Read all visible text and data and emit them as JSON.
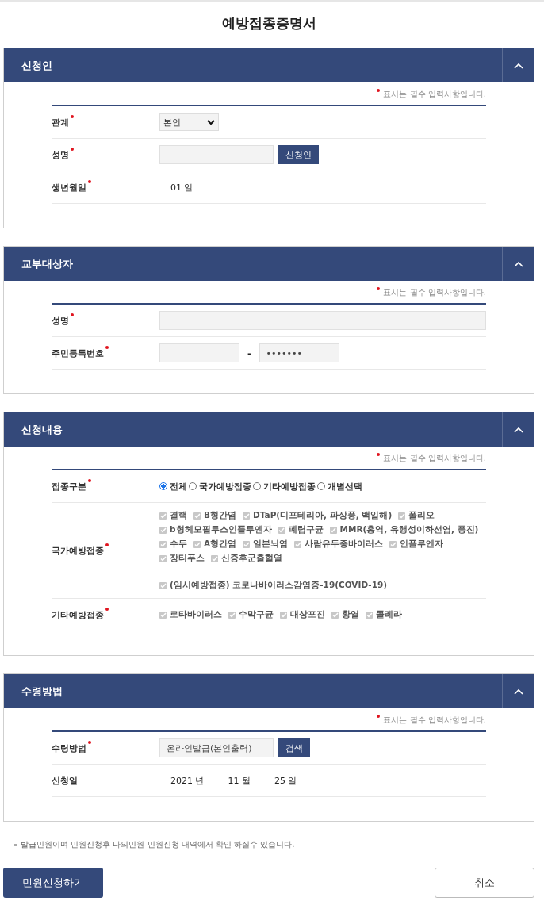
{
  "title": "예방접종증명서",
  "sections": [
    {
      "title": "신청인",
      "expanded": true,
      "note": "표시는 필수 입력사항입니다.",
      "rows": [
        {
          "kind": "select",
          "label": "관계",
          "required": true,
          "value": "본인"
        },
        {
          "kind": "text_button",
          "label": "성명",
          "required": true,
          "button": "신청인"
        },
        {
          "kind": "date",
          "label": "생년월일",
          "required": true,
          "parts": [
            {
              "value": "01",
              "unit": "일"
            }
          ]
        }
      ]
    },
    {
      "title": "교부대상자",
      "expanded": true,
      "note": "표시는 필수 입력사항입니다.",
      "rows": [
        {
          "kind": "text_wide",
          "label": "성명",
          "required": true
        },
        {
          "kind": "rrn",
          "label": "주민등록번호",
          "required": true,
          "dash": "-",
          "second": "•••••••"
        }
      ]
    },
    {
      "title": "신청내용",
      "expanded": true,
      "note": "표시는 필수 입력사항입니다.",
      "rows": [
        {
          "kind": "radio",
          "label": "접종구분",
          "required": true,
          "options": [
            {
              "label": "전체",
              "selected": true
            },
            {
              "label": "국가예방접종",
              "selected": false
            },
            {
              "label": "기타예방접종",
              "selected": false
            },
            {
              "label": "개별선택",
              "selected": false
            }
          ]
        },
        {
          "kind": "checks",
          "label": "국가예방접종",
          "required": true,
          "lines": [
            [
              {
                "label": "결핵",
                "checked": true
              },
              {
                "label": "B형간염",
                "checked": true
              },
              {
                "label": "DTaP(디프테리아, 파상풍, 백일해)",
                "checked": true
              },
              {
                "label": "폴리오",
                "checked": true
              }
            ],
            [
              {
                "label": "b형헤모필루스인플루엔자",
                "checked": true
              },
              {
                "label": "폐렴구균",
                "checked": true
              },
              {
                "label": "MMR(홍역, 유행성이하선염, 풍진)",
                "checked": true
              }
            ],
            [
              {
                "label": "수두",
                "checked": true
              },
              {
                "label": "A형간염",
                "checked": true
              },
              {
                "label": "일본뇌염",
                "checked": true
              },
              {
                "label": "사람유두종바이러스",
                "checked": true
              },
              {
                "label": "인플루엔자",
                "checked": true
              }
            ],
            [
              {
                "label": "장티푸스",
                "checked": true
              },
              {
                "label": "신증후군출혈열",
                "checked": true
              }
            ],
            [
              {
                "label": "(임시예방접종) 코로나바이러스감염증-19(COVID-19)",
                "checked": true,
                "spaced": true
              }
            ]
          ]
        },
        {
          "kind": "checks",
          "label": "기타예방접종",
          "required": true,
          "lines": [
            [
              {
                "label": "로타바이러스",
                "checked": true
              },
              {
                "label": "수막구균",
                "checked": true
              },
              {
                "label": "대상포진",
                "checked": true
              },
              {
                "label": "황열",
                "checked": true
              },
              {
                "label": "콜레라",
                "checked": true
              }
            ]
          ]
        }
      ]
    },
    {
      "title": "수령방법",
      "expanded": true,
      "note": "표시는 필수 입력사항입니다.",
      "rows": [
        {
          "kind": "text_button",
          "label": "수령방법",
          "required": true,
          "value": "온라인발급(본인출력)",
          "button": "검색"
        },
        {
          "kind": "date",
          "label": "신청일",
          "required": false,
          "parts": [
            {
              "value": "2021",
              "unit": "년"
            },
            {
              "value": "11",
              "unit": "월"
            },
            {
              "value": "25",
              "unit": "일"
            }
          ]
        }
      ]
    }
  ],
  "footnote": "발급민원이며 민원신청후 나의민원 민원신청 내역에서 확인 하실수 있습니다.",
  "buttons": [
    {
      "label": "민원신청하기",
      "kind": "primary"
    },
    {
      "label": "취소",
      "kind": "secondary"
    }
  ]
}
